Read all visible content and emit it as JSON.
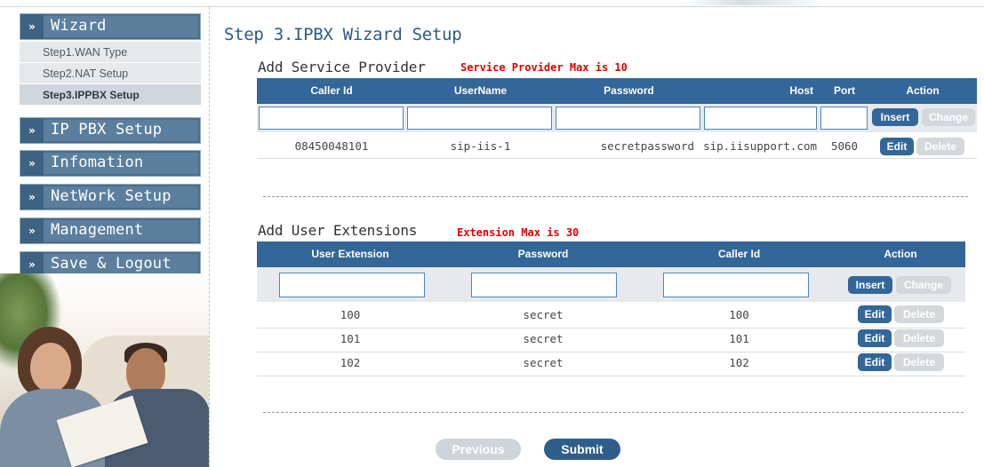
{
  "sidebar": {
    "menu_arrow": "»",
    "wizard_label": "Wizard",
    "wizard_steps": [
      "Step1.WAN Type",
      "Step2.NAT Setup",
      "Step3.IPPBX Setup"
    ],
    "menus": [
      "IP PBX Setup",
      "Infomation",
      "NetWork Setup",
      "Management",
      "Save & Logout"
    ]
  },
  "page_title": "Step 3.IPBX Wizard Setup",
  "service_provider": {
    "title": "Add Service Provider",
    "note": "Service Provider Max is 10",
    "columns": [
      "Caller Id",
      "UserName",
      "Password",
      "Host",
      "Port",
      "Action"
    ],
    "inputs": {
      "caller_id": "",
      "username": "",
      "password": "",
      "host": "",
      "port": ""
    },
    "insert_label": "Insert",
    "change_label": "Change",
    "rows": [
      {
        "caller_id": "08450048101",
        "username": "sip-iis-1",
        "password": "secretpassword",
        "host": "sip.iisupport.com",
        "port": "5060",
        "edit": "Edit",
        "delete": "Delete"
      }
    ]
  },
  "user_extensions": {
    "title": "Add User Extensions",
    "note": "Extension Max is 30",
    "columns": [
      "User Extension",
      "Password",
      "Caller Id",
      "Action"
    ],
    "inputs": {
      "extension": "",
      "password": "",
      "caller_id": ""
    },
    "insert_label": "Insert",
    "change_label": "Change",
    "rows": [
      {
        "extension": "100",
        "password": "secret",
        "caller_id": "100",
        "edit": "Edit",
        "delete": "Delete"
      },
      {
        "extension": "101",
        "password": "secret",
        "caller_id": "101",
        "edit": "Edit",
        "delete": "Delete"
      },
      {
        "extension": "102",
        "password": "secret",
        "caller_id": "102",
        "edit": "Edit",
        "delete": "Delete"
      }
    ]
  },
  "footer": {
    "previous": "Previous",
    "submit": "Submit"
  },
  "colors": {
    "header_blue": "#336699",
    "note_red": "#e00000",
    "menu_blue": "#5b7f9c",
    "title_blue": "#2c5a86"
  }
}
